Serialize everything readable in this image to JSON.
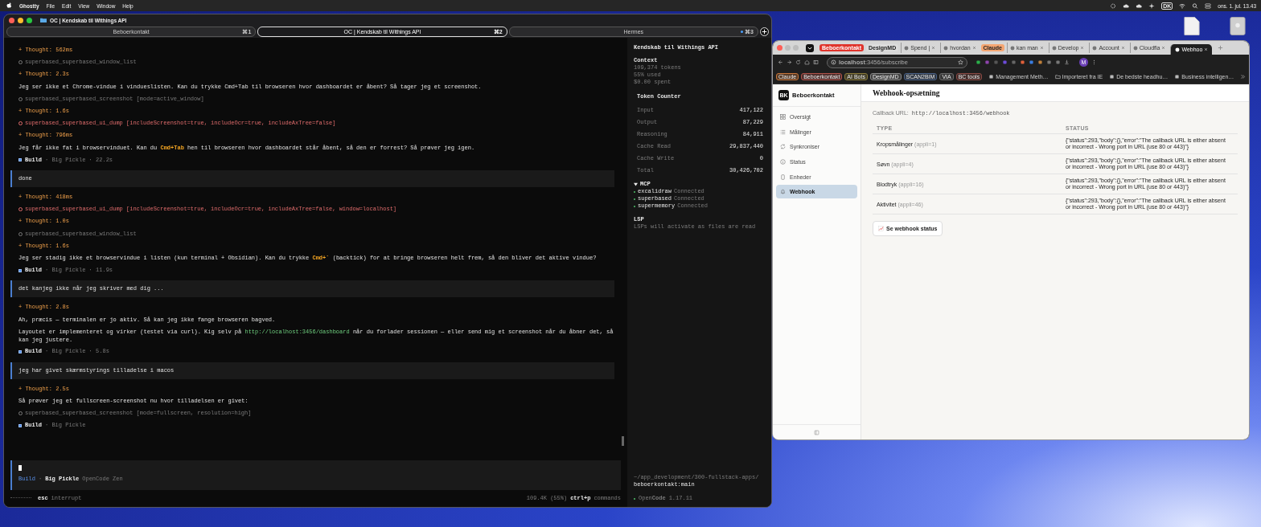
{
  "menubar": {
    "app": "Ghostty",
    "menus": [
      "File",
      "Edit",
      "View",
      "Window",
      "Help"
    ],
    "input_source": "DK",
    "clock": "ons. 1. jul. 13.43"
  },
  "terminal": {
    "title": "OC | Kendskab til Withings API",
    "tabs": [
      {
        "label": "Beboerkontakt",
        "shortcut": "⌘1",
        "selected": false,
        "activity": false
      },
      {
        "label": "OC | Kendskab til Withings API",
        "shortcut": "⌘2",
        "selected": true,
        "activity": false
      },
      {
        "label": "Hermes",
        "shortcut": "⌘3",
        "selected": false,
        "activity": true
      }
    ],
    "transcript": [
      {
        "kind": "thought",
        "text": "+ Thought: 562ms"
      },
      {
        "kind": "tool",
        "failed": false,
        "text": "superbased_superbased_window_list"
      },
      {
        "kind": "thought",
        "text": "+ Thought: 2.3s"
      },
      {
        "kind": "message",
        "segments": [
          {
            "kind": "plain",
            "text": "Jeg ser ikke et Chrome-vindue i vindueslisten. Kan du trykke Cmd+Tab til browseren hvor dashboardet er åbent? Så tager jeg et screenshot."
          }
        ]
      },
      {
        "kind": "tool",
        "failed": false,
        "text": "superbased_superbased_screenshot [mode=active_window]"
      },
      {
        "kind": "thought",
        "text": "+ Thought: 1.6s"
      },
      {
        "kind": "tool",
        "failed": true,
        "text": "superbased_superbased_ui_dump [includeScreenshot=true, includeOcr=true, includeAxTree=false]"
      },
      {
        "kind": "thought",
        "text": "+ Thought: 796ms"
      },
      {
        "kind": "message",
        "segments": [
          {
            "kind": "plain",
            "text": "Jeg får ikke fat i browservinduet. Kan du "
          },
          {
            "kind": "key",
            "text": "Cmd+Tab"
          },
          {
            "kind": "plain",
            "text": " hen til browseren hvor dashboardet står åbent, så den er forrest? Så prøver jeg igen."
          }
        ]
      },
      {
        "kind": "build",
        "agent": "Build",
        "meta": "· Big Pickle · 22.2s"
      },
      {
        "kind": "user",
        "text": "done"
      },
      {
        "kind": "thought",
        "text": "+ Thought: 418ms"
      },
      {
        "kind": "tool",
        "failed": true,
        "text": "superbased_superbased_ui_dump [includeScreenshot=true, includeOcr=true, includeAxTree=false, window=localhost]"
      },
      {
        "kind": "thought",
        "text": "+ Thought: 1.0s"
      },
      {
        "kind": "tool",
        "failed": false,
        "text": "superbased_superbased_window_list"
      },
      {
        "kind": "thought",
        "text": "+ Thought: 1.6s"
      },
      {
        "kind": "message",
        "segments": [
          {
            "kind": "plain",
            "text": "Jeg ser stadig ikke et browservindue i listen (kun terminal + Obsidian). Kan du trykke "
          },
          {
            "kind": "key",
            "text": "Cmd+`"
          },
          {
            "kind": "plain",
            "text": " (backtick) for at bringe browseren helt frem, så den bliver det aktive vindue?"
          }
        ]
      },
      {
        "kind": "build",
        "agent": "Build",
        "meta": "· Big Pickle · 11.9s"
      },
      {
        "kind": "user",
        "text": "det kanjeg ikke når jeg skriver med dig ..."
      },
      {
        "kind": "thought",
        "text": "+ Thought: 2.8s"
      },
      {
        "kind": "message",
        "segments": [
          {
            "kind": "plain",
            "text": "Ah, præcis — terminalen er jo aktiv. Så kan jeg ikke fange browseren bagved."
          }
        ]
      },
      {
        "kind": "message",
        "segments": [
          {
            "kind": "plain",
            "text": "Layoutet er implementeret og virker (testet via curl). Kig selv på "
          },
          {
            "kind": "link",
            "text": "http://localhost:3456/dashboard"
          },
          {
            "kind": "plain",
            "text": " når du forlader sessionen — eller send mig et screenshot når du åbner det, så kan jeg justere."
          }
        ]
      },
      {
        "kind": "build",
        "agent": "Build",
        "meta": "· Big Pickle · 5.8s"
      },
      {
        "kind": "user",
        "text": "jeg har givet skærmstyrings tilladelse i macos"
      },
      {
        "kind": "thought",
        "text": "+ Thought: 2.5s"
      },
      {
        "kind": "message",
        "segments": [
          {
            "kind": "plain",
            "text": "Så prøver jeg et fullscreen-screenshot nu hvor tilladelsen er givet:"
          }
        ]
      },
      {
        "kind": "tool",
        "failed": false,
        "text": "superbased_superbased_screenshot [mode=fullscreen, resolution=high]"
      },
      {
        "kind": "build",
        "agent": "Build",
        "meta": "· Big Pickle"
      }
    ],
    "input": {
      "agent": "Build",
      "separator": "·",
      "model": "Big Pickle",
      "provider": "OpenCode Zen"
    },
    "status": {
      "key": "esc",
      "action": "interrupt",
      "usage": "109.4K (55%)",
      "shortcut": "ctrl+p",
      "shortcut_action": "commands"
    },
    "sidebar": {
      "title": "Kendskab til Withings API",
      "context_heading": "Context",
      "context_lines": [
        "109,374 tokens",
        "55% used",
        "$0.00 spent"
      ],
      "token_heading": "Token Counter",
      "tokens": [
        {
          "label": "Input",
          "value": "417,122"
        },
        {
          "label": "Output",
          "value": "87,229"
        },
        {
          "label": "Reasoning",
          "value": "84,911"
        },
        {
          "label": "Cache Read",
          "value": "29,837,440"
        },
        {
          "label": "Cache Write",
          "value": "0"
        },
        {
          "label": "Total",
          "value": "30,426,702"
        }
      ],
      "mcp": {
        "heading": "MCP",
        "expanded": true,
        "servers": [
          {
            "name": "excalidraw",
            "status": "Connected"
          },
          {
            "name": "superbased",
            "status": "Connected"
          },
          {
            "name": "supermemory",
            "status": "Connected"
          }
        ]
      },
      "lsp_heading": "LSP",
      "lsp_text": "LSPs will activate as files are read",
      "path": "~/app_development/300-fullstack-apps/",
      "branch": "beboerkontakt:main",
      "product": "Open**Code**",
      "version": "1.17.11"
    }
  },
  "browser": {
    "tabs": [
      {
        "kind": "group",
        "label": "Beboerkontakt",
        "color": "#e0342c"
      },
      {
        "kind": "group",
        "label": "DesignMD",
        "color": "#dcdcdc"
      },
      {
        "kind": "tab",
        "label": "Spend |",
        "selected": false
      },
      {
        "kind": "tab",
        "label": "hvordan",
        "selected": false
      },
      {
        "kind": "group",
        "label": "Claude",
        "color": "#f5a672"
      },
      {
        "kind": "tab",
        "label": "kan man",
        "selected": false
      },
      {
        "kind": "tab",
        "label": "Develop",
        "selected": false
      },
      {
        "kind": "tab",
        "label": "Account",
        "selected": false
      },
      {
        "kind": "tab",
        "label": "Cloudfla",
        "selected": false
      },
      {
        "kind": "tab",
        "label": "Webhoo",
        "selected": true
      }
    ],
    "url": "**localhost**:3456/subscribe",
    "profile": "M",
    "bookmarks": [
      {
        "kind": "group",
        "label": "Claude",
        "color": "#c8763a"
      },
      {
        "kind": "group",
        "label": "Beboerkontakt",
        "color": "#b0524a"
      },
      {
        "kind": "group",
        "label": "AI Bots",
        "color": "#8a7a3a"
      },
      {
        "kind": "group",
        "label": "DesignMD",
        "color": "#8a8a8a"
      },
      {
        "kind": "group",
        "label": "SCAN2BIM",
        "color": "#4a6288"
      },
      {
        "kind": "group",
        "label": "VIA",
        "color": "#6a6a6a"
      },
      {
        "kind": "group",
        "label": "BC tools",
        "color": "#8a4a44"
      },
      {
        "kind": "bookmark",
        "label": "Management Meth…"
      },
      {
        "kind": "folder",
        "label": "Importeret fra IE"
      },
      {
        "kind": "bookmark",
        "label": "De bedste headhu…"
      },
      {
        "kind": "bookmark",
        "label": "Business intelligen…"
      }
    ]
  },
  "app": {
    "logo": "BK",
    "brand": "Beboerkontakt",
    "nav": [
      {
        "label": "Oversigt",
        "selected": false
      },
      {
        "label": "Målinger",
        "selected": false
      },
      {
        "label": "Synkroniser",
        "selected": false
      },
      {
        "label": "Status",
        "selected": false
      },
      {
        "label": "Enheder",
        "selected": false
      },
      {
        "label": "Webhook",
        "selected": true
      }
    ],
    "title": "Webhook-opsætning",
    "callback_label": "Callback URL:",
    "callback_url": "http://localhost:3456/webhook",
    "columns": [
      "TYPE",
      "STATUS"
    ],
    "rows": [
      {
        "type": "Kropsmålinger",
        "appli": "(appli=1)",
        "status": "{\"status\":293,\"body\":{},\"error\":\"The callback URL is either absent or incorrect - Wrong port in URL (use 80 or 443)\"}"
      },
      {
        "type": "Søvn",
        "appli": "(appli=4)",
        "status": "{\"status\":293,\"body\":{},\"error\":\"The callback URL is either absent or incorrect - Wrong port in URL (use 80 or 443)\"}"
      },
      {
        "type": "Blodtryk",
        "appli": "(appli=16)",
        "status": "{\"status\":293,\"body\":{},\"error\":\"The callback URL is either absent or incorrect - Wrong port in URL (use 80 or 443)\"}"
      },
      {
        "type": "Aktivitet",
        "appli": "(appli=46)",
        "status": "{\"status\":293,\"body\":{},\"error\":\"The callback URL is either absent or incorrect - Wrong port in URL (use 80 or 443)\"}"
      }
    ],
    "button": "Se webhook status"
  }
}
